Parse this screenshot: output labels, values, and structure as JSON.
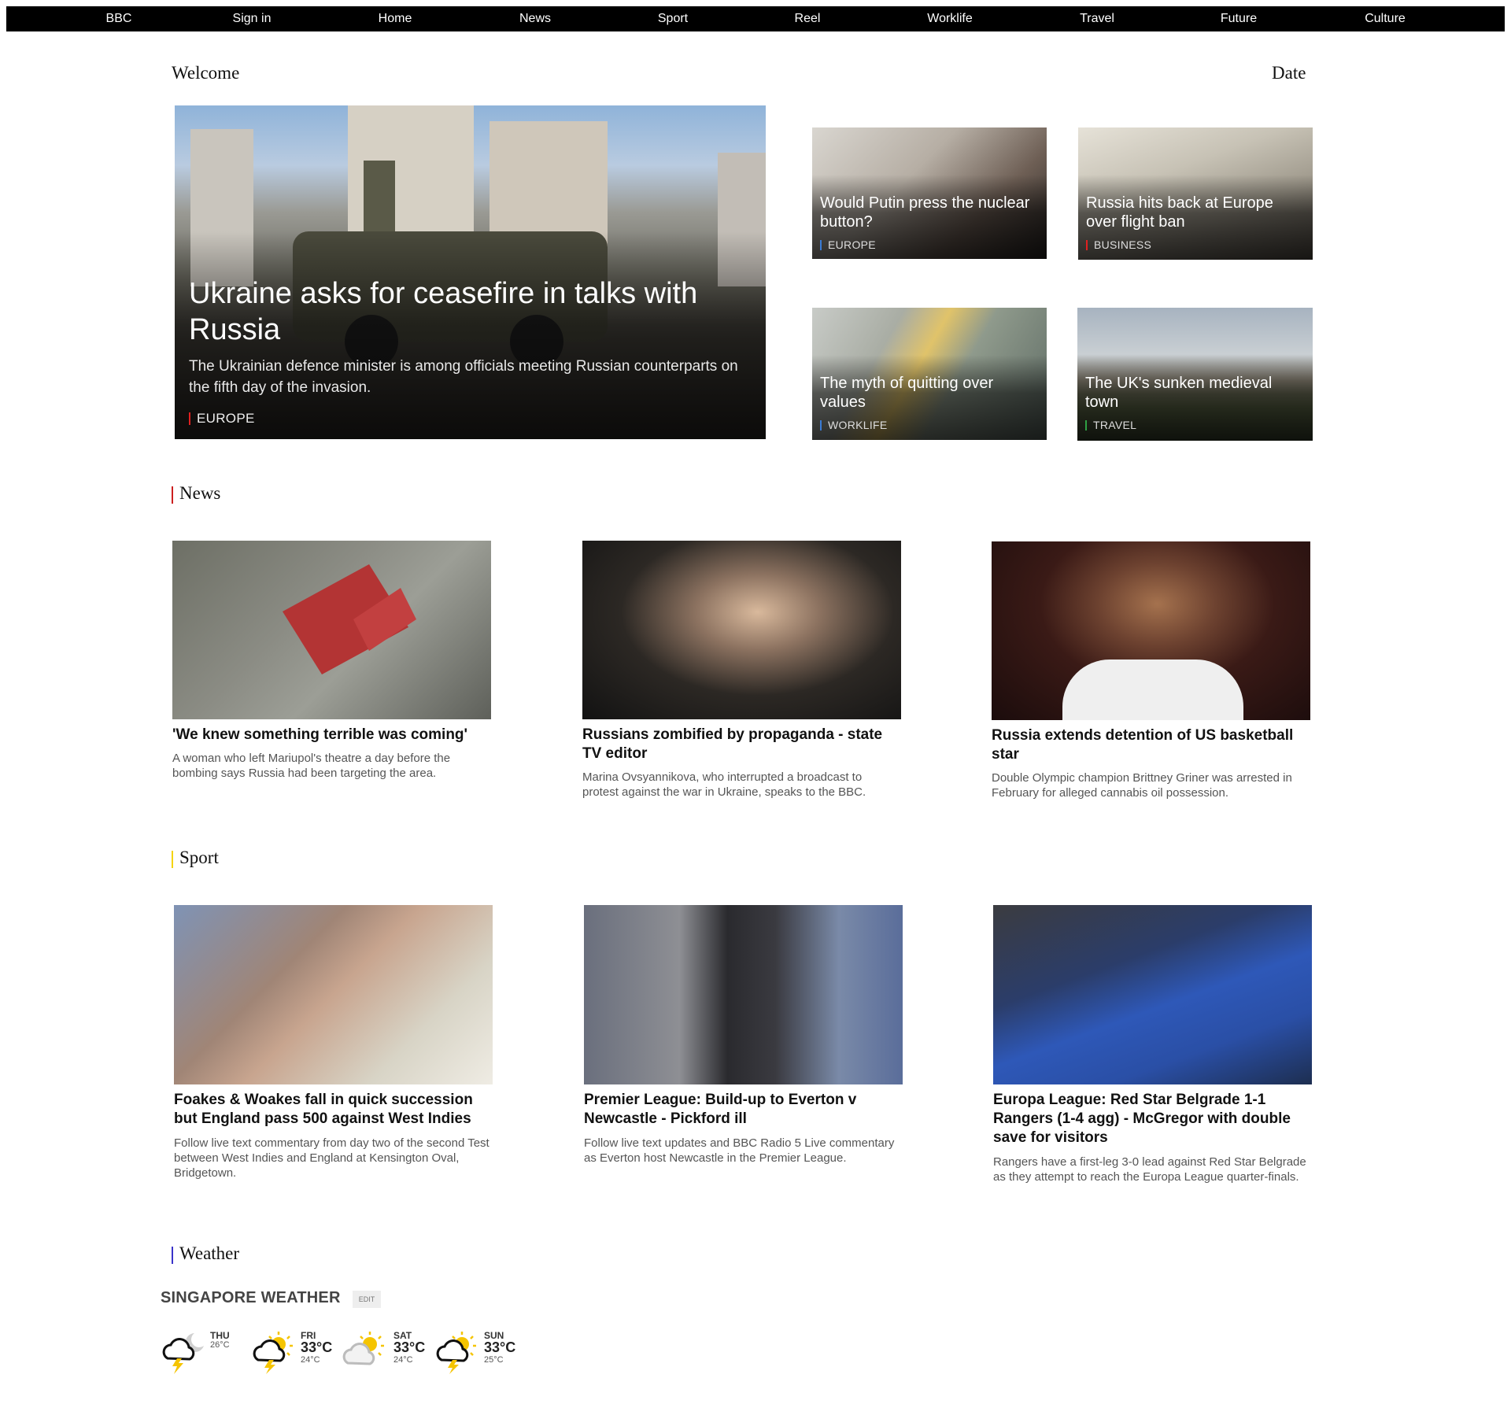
{
  "nav": {
    "items": [
      "BBC",
      "Sign in",
      "Home",
      "News",
      "Sport",
      "Reel",
      "Worklife",
      "Travel",
      "Future",
      "Culture"
    ]
  },
  "header": {
    "welcome": "Welcome",
    "date": "Date"
  },
  "hero": {
    "title": "Ukraine asks for ceasefire in talks with Russia",
    "summary": "The Ukrainian defence minister is among officials meeting Russian counterparts on the fifth day of the invasion.",
    "tag": "EUROPE",
    "tag_color": "#e02020"
  },
  "top_stories": [
    {
      "title": "Would Putin press the nuclear button?",
      "tag": "EUROPE",
      "tag_color": "#3a7bd5"
    },
    {
      "title": "Russia hits back at Europe over flight ban",
      "tag": "BUSINESS",
      "tag_color": "#e02020"
    },
    {
      "title": "The myth of quitting over values",
      "tag": "WORKLIFE",
      "tag_color": "#3a7bd5"
    },
    {
      "title": "The UK's sunken medieval town",
      "tag": "TRAVEL",
      "tag_color": "#2ea043"
    }
  ],
  "news": {
    "heading": "News",
    "accent": "#cc1f1f",
    "cards": [
      {
        "title": "'We knew something terrible was coming'",
        "summary": "A woman who left Mariupol's theatre a day before the bombing says Russia had been targeting the area."
      },
      {
        "title": "Russians zombified by propaganda - state TV editor",
        "summary": "Marina Ovsyannikova, who interrupted a broadcast to protest against the war in Ukraine, speaks to the BBC."
      },
      {
        "title": "Russia extends detention of US basketball star",
        "summary": "Double Olympic champion Brittney Griner was arrested in February for alleged cannabis oil possession."
      }
    ]
  },
  "sport": {
    "heading": "Sport",
    "accent": "#f5d40a",
    "cards": [
      {
        "title": "Foakes & Woakes fall in quick succession but England pass 500 against West Indies",
        "summary": "Follow live text commentary from day two of the second Test between West Indies and England at Kensington Oval, Bridgetown."
      },
      {
        "title": "Premier League: Build-up to Everton v Newcastle - Pickford ill",
        "summary": "Follow live text updates and BBC Radio 5 Live commentary as Everton host Newcastle in the Premier League."
      },
      {
        "title": "Europa League: Red Star Belgrade 1-1 Rangers (1-4 agg) - McGregor with double save for visitors",
        "summary": "Rangers have a first-leg 3-0 lead against Red Star Belgrade as they attempt to reach the Europa League quarter-finals."
      }
    ]
  },
  "weather": {
    "heading": "Weather",
    "accent": "#3b33c9",
    "title": "SINGAPORE WEATHER",
    "edit_label": "EDIT",
    "days": [
      {
        "day": "THU",
        "high": "",
        "low": "26°C",
        "icon": "night-thunderstorm-icon"
      },
      {
        "day": "FRI",
        "high": "33°C",
        "low": "24°C",
        "icon": "sun-thunderstorm-icon"
      },
      {
        "day": "SAT",
        "high": "33°C",
        "low": "24°C",
        "icon": "sun-cloud-icon"
      },
      {
        "day": "SUN",
        "high": "33°C",
        "low": "25°C",
        "icon": "sun-thunderstorm-icon"
      }
    ]
  }
}
